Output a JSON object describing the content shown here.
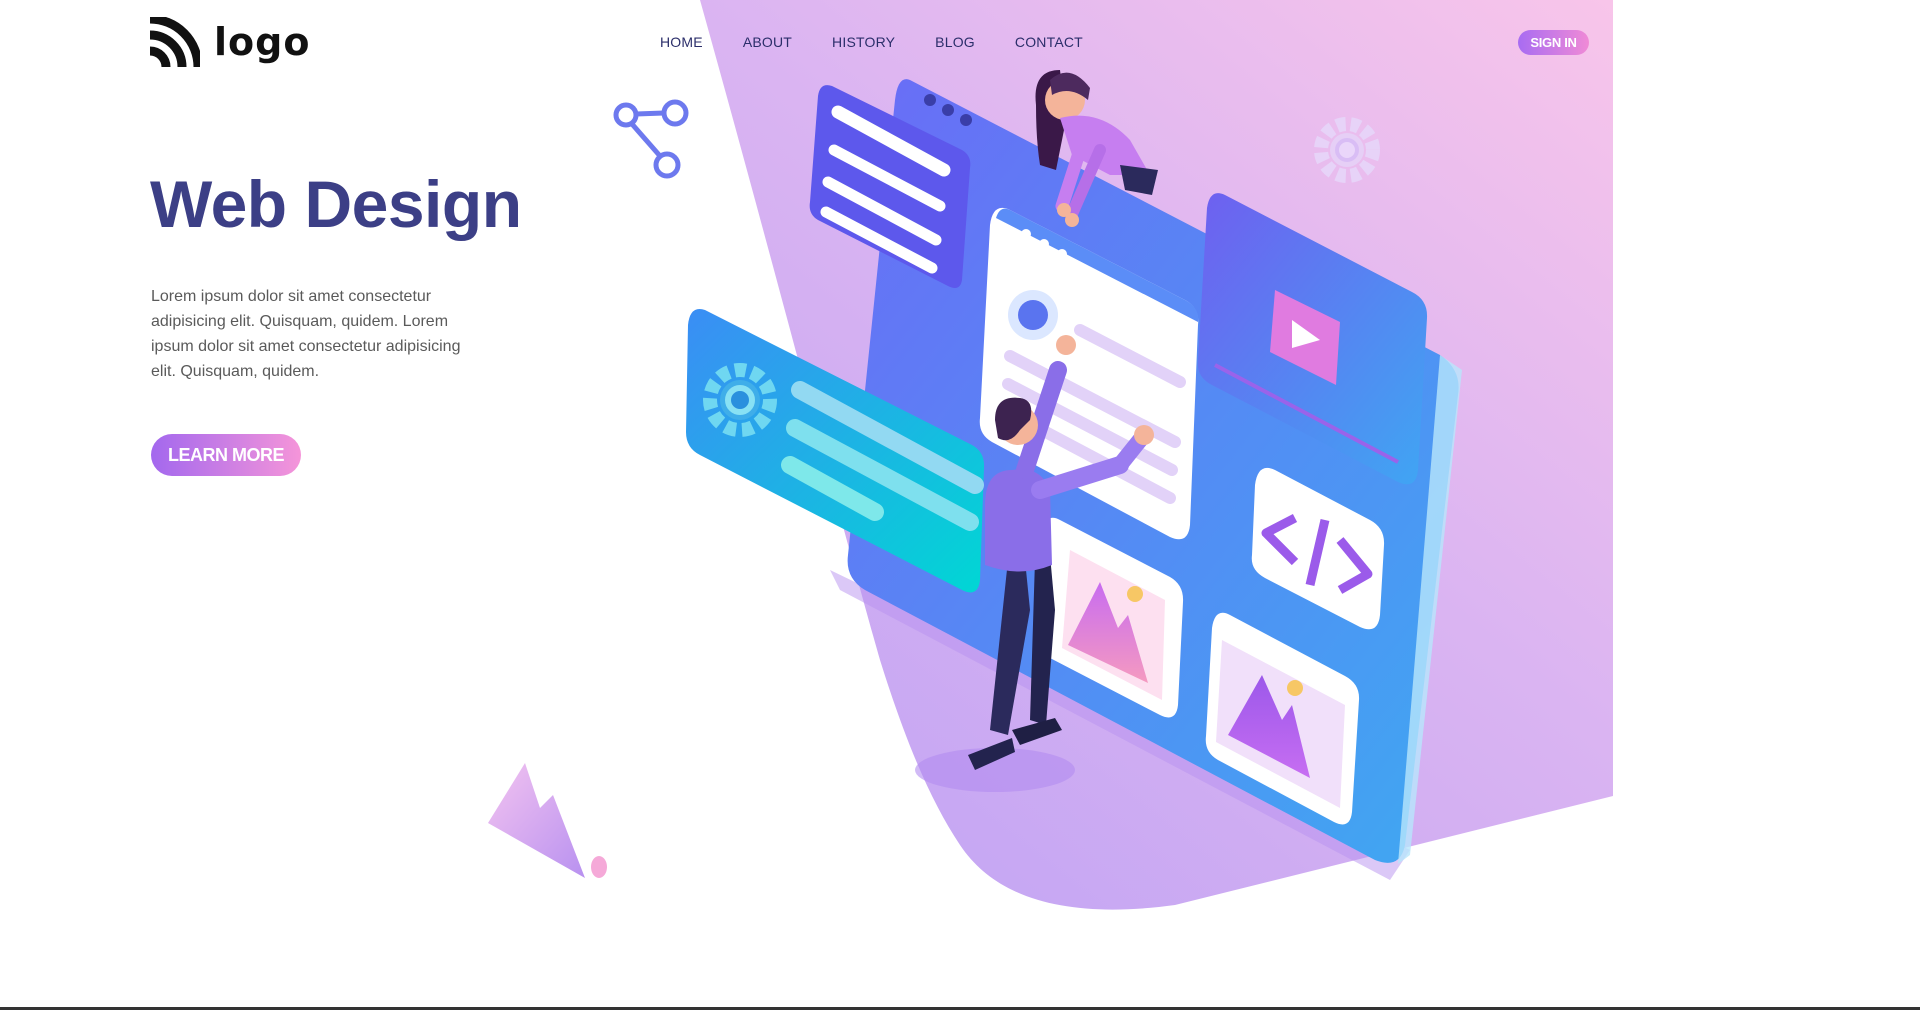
{
  "header": {
    "logo_text": "logo",
    "logo_icon": "wifi-arcs-icon",
    "nav": [
      "HOME",
      "ABOUT",
      "HISTORY",
      "BLOG",
      "CONTACT"
    ],
    "signin_label": "SIGN IN"
  },
  "hero": {
    "title": "Web Design",
    "text": "Lorem ipsum dolor sit amet consectetur adipisicing elit. Quisquam, quidem. Lorem ipsum dolor sit amet consectetur adipisicing elit. Quisquam, quidem.",
    "button_label": "LEARN MORE"
  },
  "colors": {
    "title": "#3c3f86",
    "nav": "#2b2e6a",
    "accent_start": "#a368ee",
    "accent_end": "#f595d9",
    "background_gradient_top": "#f6c4ec",
    "background_gradient_bottom": "#c4a6f4"
  },
  "illustration": {
    "icons": [
      "share-icon",
      "gear-icon",
      "code-icon",
      "image-icon",
      "play-icon",
      "mountain-decoration"
    ]
  }
}
